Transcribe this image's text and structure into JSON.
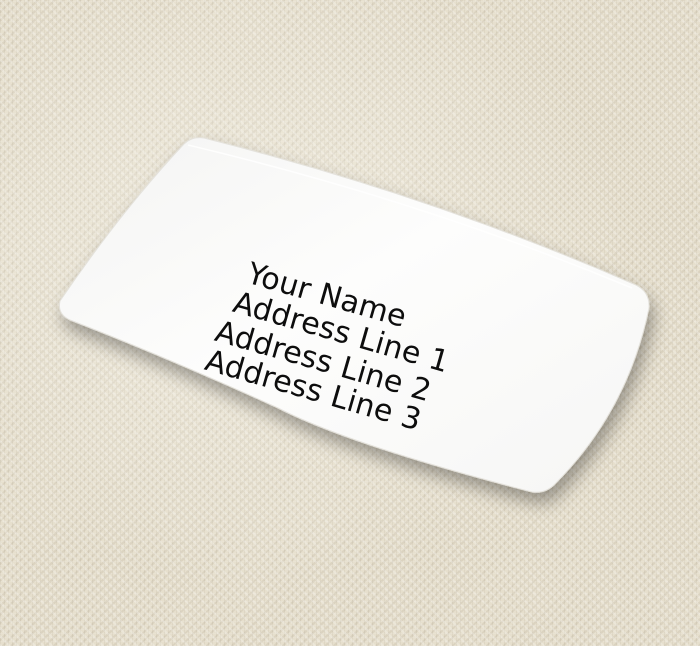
{
  "label": {
    "lines": [
      "Your Name",
      "Address Line 1",
      "Address Line 2",
      "Address Line 3"
    ]
  },
  "colors": {
    "fabric": "#e6dfcd",
    "label_face": "#fcfcfb",
    "text": "#0d0d0d"
  }
}
